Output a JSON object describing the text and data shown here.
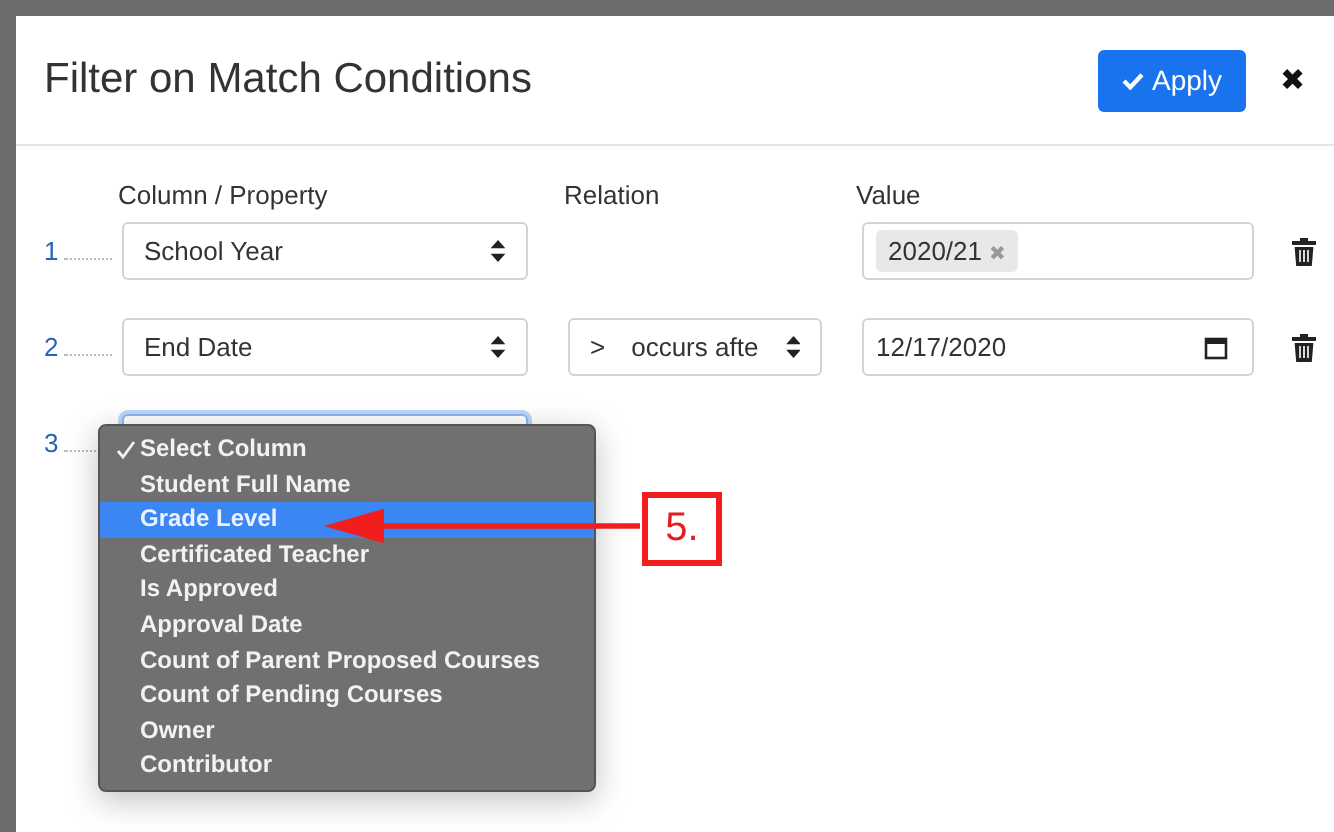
{
  "dialog": {
    "title": "Filter on Match Conditions",
    "apply_button": "Apply",
    "close": "✖"
  },
  "headers": [
    "Column / Property",
    "Relation",
    "Value"
  ],
  "rows": [
    {
      "number": "1",
      "column": "School Year",
      "value": {
        "kind": "tag",
        "text": "2020/21",
        "remove": "✖"
      }
    },
    {
      "number": "2",
      "column": "End Date",
      "relation": {
        "operator": ">",
        "text": "occurs afte"
      },
      "value": {
        "kind": "date",
        "text": "12/17/2020"
      }
    },
    {
      "number": "3"
    }
  ],
  "menu": [
    {
      "label": "Select Column",
      "checked": true,
      "selected": false
    },
    {
      "label": "Student Full Name",
      "checked": false,
      "selected": false
    },
    {
      "label": "Grade Level",
      "checked": false,
      "selected": true
    },
    {
      "label": "Certificated Teacher",
      "checked": false,
      "selected": false
    },
    {
      "label": "Is Approved",
      "checked": false,
      "selected": false
    },
    {
      "label": "Approval Date",
      "checked": false,
      "selected": false
    },
    {
      "label": "Count of Parent Proposed Courses",
      "checked": false,
      "selected": false
    },
    {
      "label": "Count of Pending Courses",
      "checked": false,
      "selected": false
    },
    {
      "label": "Owner",
      "checked": false,
      "selected": false
    },
    {
      "label": "Contributor",
      "checked": false,
      "selected": false
    }
  ],
  "callout": {
    "label": "5."
  }
}
